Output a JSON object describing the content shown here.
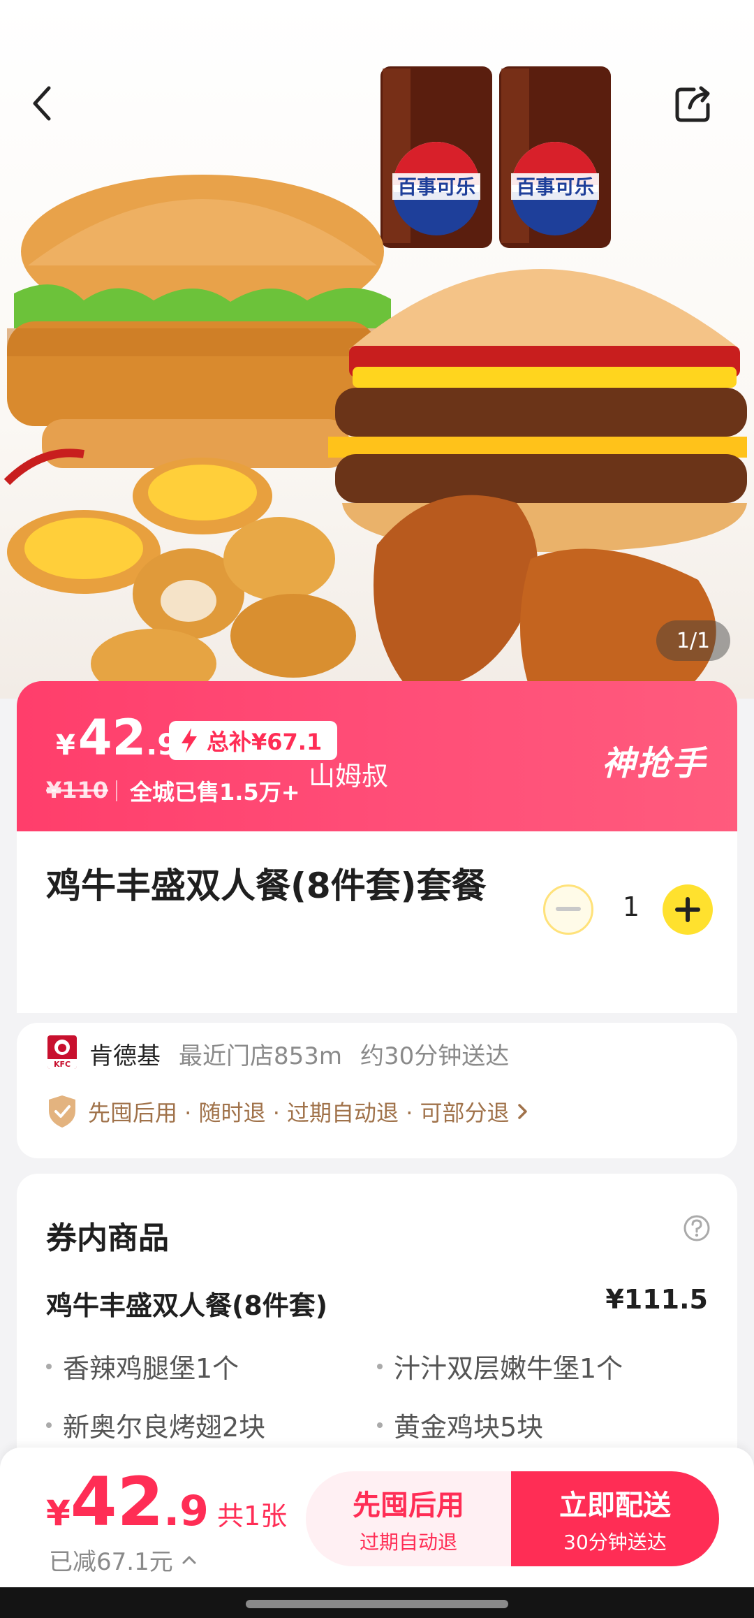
{
  "hero": {
    "image_counter": "1/1",
    "cup_label": "百事可乐"
  },
  "price_banner": {
    "currency": "¥",
    "price_int": "42",
    "price_dec": ".9",
    "subsidy_label": "总补¥67.1",
    "original_price": "¥110",
    "sold_text": "全城已售1.5万+",
    "brand_label": "神抢手",
    "watermark": "山姆叔"
  },
  "product": {
    "title": "鸡牛丰盛双人餐(8件套)套餐",
    "quantity": "1"
  },
  "store": {
    "logo_text": "KFC",
    "name": "肯德基",
    "distance": "最近门店853m",
    "delivery": "约30分钟送达",
    "policy": "先囤后用 · 随时退 · 过期自动退 · 可部分退"
  },
  "coupon": {
    "title": "券内商品",
    "meal_name": "鸡牛丰盛双人餐(8件套)",
    "meal_price": "¥111.5",
    "items": [
      "香辣鸡腿堡1个",
      "汁汁双层嫩牛堡1个",
      "新奥尔良烤翅2块",
      "黄金鸡块5块"
    ]
  },
  "bottom_bar": {
    "currency": "¥",
    "price_int": "42",
    "price_dec": ".9",
    "count": "共1张",
    "saved": "已减67.1元",
    "btn_later_main": "先囤后用",
    "btn_later_sub": "过期自动退",
    "btn_now_main": "立即配送",
    "btn_now_sub": "30分钟送达"
  },
  "colors": {
    "accent": "#ff2d55",
    "banner": "#ff4d77",
    "qty_plus": "#ffe12e",
    "policy": "#a0724a"
  }
}
